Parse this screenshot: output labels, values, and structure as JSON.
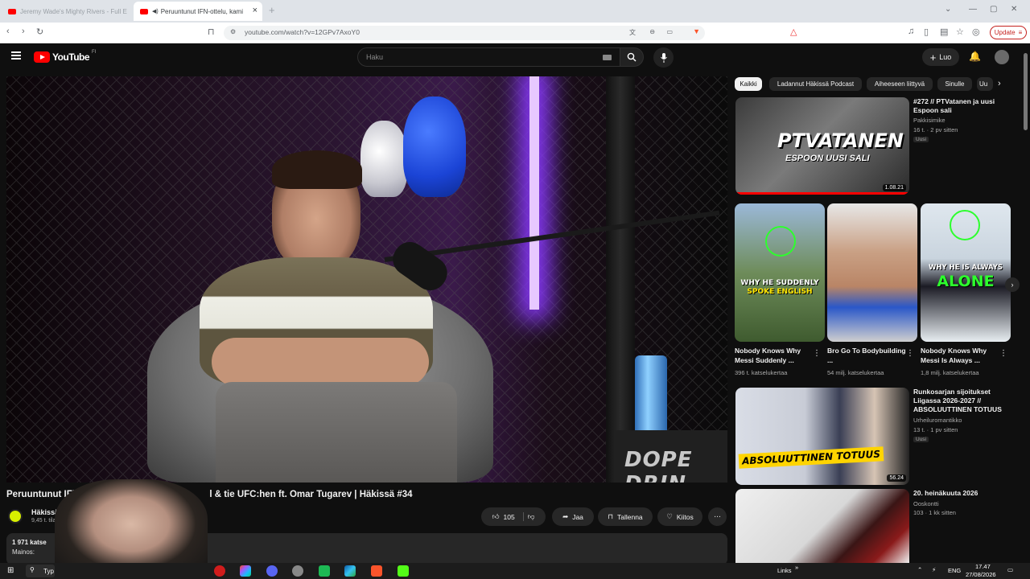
{
  "browser": {
    "tabs": [
      {
        "label": "Jeremy Wade's Mighty Rivers - Full E"
      },
      {
        "label": "Peruuntunut IFN-ottelu, kami"
      }
    ],
    "url": "youtube.com/watch?v=12GPv7AxoY0",
    "update_label": "Update"
  },
  "header": {
    "logo_text": "YouTube",
    "country": "FI",
    "search_placeholder": "Haku",
    "create_label": "Luo"
  },
  "player": {
    "chips_text": "DOPE DRIN",
    "can_label": "",
    "colors": {
      "neon": "#b266ff",
      "glove": "#2255ff"
    }
  },
  "video": {
    "title": "Peruuntunut IFN-ottelu, kamppailu & tie UFC:hen ft. Omar Tugarev | Häkissä #34",
    "title_visible_start": "Peruuntunut IFN-",
    "title_visible_end": "l & tie UFC:hen ft. Omar Tugarev | Häkissä #34",
    "channel_name": "Häkissä Pr",
    "channel_subs": "9,45 t. tilaa",
    "likes": "105",
    "share_label": "Jaa",
    "save_label": "Tallenna",
    "thanks_label": "Kiitos",
    "views": "1 971 katse",
    "mainos": "Mainos:"
  },
  "chips": [
    {
      "label": "Kaikki",
      "active": true
    },
    {
      "label": "Ladannut Häkissä Podcast",
      "active": false
    },
    {
      "label": "Aiheeseen liittyvä",
      "active": false
    },
    {
      "label": "Sinulle",
      "active": false
    },
    {
      "label": "Uu",
      "active": false
    }
  ],
  "sidebar": {
    "video1": {
      "title": "#272 // PTVatanen ja uusi Espoon sali",
      "channel": "Pakkisimike",
      "stats": "16 t. · 2 pv sitten",
      "badge": "Uusi",
      "duration": "1.08.21",
      "thumb_text_1": "PTVATANEN",
      "thumb_text_2": "ESPOON UUSI SALI"
    },
    "shorts": [
      {
        "title": "Nobody Knows Why Messi Suddenly ...",
        "views": "396 t. katselukertaa",
        "cap_top": "WHY HE SUDDENLY",
        "cap_bottom": "SPOKE ENGLISH"
      },
      {
        "title": "Bro Go To Bodybuilding ...",
        "views": "54 milj. katselukertaa",
        "cap_top": "",
        "cap_bottom": ""
      },
      {
        "title": "Nobody Knows Why Messi Is Always ...",
        "views": "1,8 milj. katselukertaa",
        "cap_top": "WHY HE IS ALWAYS",
        "cap_bottom": "ALONE"
      }
    ],
    "video2": {
      "title": "Runkosarjan sijoitukset Liigassa 2026-2027 // ABSOLUUTTINEN TOTUUS",
      "channel": "Urheiluromantikko",
      "stats": "13 t. · 1 pv sitten",
      "badge": "Uusi",
      "duration": "56.24",
      "thumb_text": "ABSOLUUTTINEN TOTUUS"
    },
    "video3": {
      "title": "20. heinäkuuta 2026",
      "channel": "Ooskontti",
      "stats": "103 · 1 kk sitten"
    }
  },
  "taskbar": {
    "search_text": "Typ",
    "links_label": "Links",
    "lang": "ENG",
    "time": "17.47",
    "date": "27/08/2026"
  }
}
